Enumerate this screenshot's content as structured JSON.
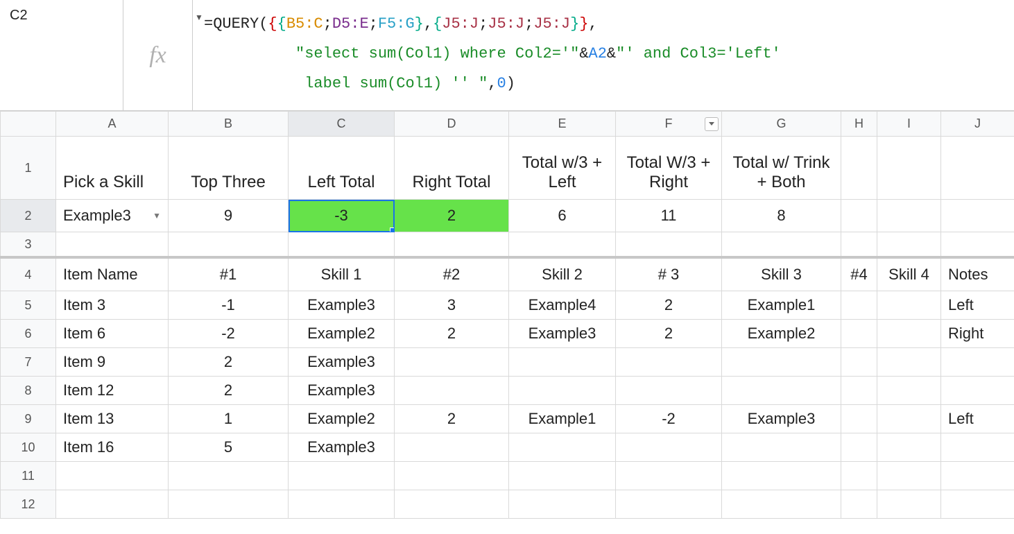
{
  "nameBox": "C2",
  "formula": {
    "fn": "QUERY",
    "rB": "B5:C",
    "rD": "D5:E",
    "rF": "F5:G",
    "rJ": "J5:J",
    "line2a": "\"select sum(Col1) where Col2='\"",
    "rA2": "A2",
    "line2b": "\"' and Col3='Left'",
    "line3": " label sum(Col1) '' \"",
    "amp": "&",
    "comma": ",",
    "semi": ";",
    "zero": "0"
  },
  "columns": [
    "A",
    "B",
    "C",
    "D",
    "E",
    "F",
    "G",
    "H",
    "I",
    "J"
  ],
  "rows": [
    "1",
    "2",
    "3",
    "4",
    "5",
    "6",
    "7",
    "8",
    "9",
    "10",
    "11",
    "12"
  ],
  "header1": {
    "A": "Pick a Skill",
    "B": "Top Three",
    "C": "Left Total",
    "D": "Right Total",
    "E": "Total w/3 + Left",
    "F": "Total W/3 + Right",
    "G": "Total w/ Trink + Both",
    "H": "",
    "I": "",
    "J": ""
  },
  "row2": {
    "A": "Example3",
    "B": "9",
    "C": "-3",
    "D": "2",
    "E": "6",
    "F": "11",
    "G": "8",
    "H": "",
    "I": "",
    "J": ""
  },
  "header4": {
    "A": "Item Name",
    "B": "#1",
    "C": "Skill 1",
    "D": "#2",
    "E": "Skill 2",
    "F": "# 3",
    "G": "Skill 3",
    "H": "#4",
    "I": "Skill 4",
    "J": "Notes"
  },
  "data": [
    {
      "A": "Item 3",
      "B": "-1",
      "C": "Example3",
      "D": "3",
      "E": "Example4",
      "F": "2",
      "G": "Example1",
      "H": "",
      "I": "",
      "J": "Left"
    },
    {
      "A": "Item 6",
      "B": "-2",
      "C": "Example2",
      "D": "2",
      "E": "Example3",
      "F": "2",
      "G": "Example2",
      "H": "",
      "I": "",
      "J": "Right"
    },
    {
      "A": "Item 9",
      "B": "2",
      "C": "Example3",
      "D": "",
      "E": "",
      "F": "",
      "G": "",
      "H": "",
      "I": "",
      "J": ""
    },
    {
      "A": "Item 12",
      "B": "2",
      "C": "Example3",
      "D": "",
      "E": "",
      "F": "",
      "G": "",
      "H": "",
      "I": "",
      "J": ""
    },
    {
      "A": "Item 13",
      "B": "1",
      "C": "Example2",
      "D": "2",
      "E": "Example1",
      "F": "-2",
      "G": "Example3",
      "H": "",
      "I": "",
      "J": "Left"
    },
    {
      "A": "Item 16",
      "B": "5",
      "C": "Example3",
      "D": "",
      "E": "",
      "F": "",
      "G": "",
      "H": "",
      "I": "",
      "J": ""
    }
  ],
  "colors": {
    "highlight": "#66e24a",
    "selection": "#1a73e8"
  }
}
